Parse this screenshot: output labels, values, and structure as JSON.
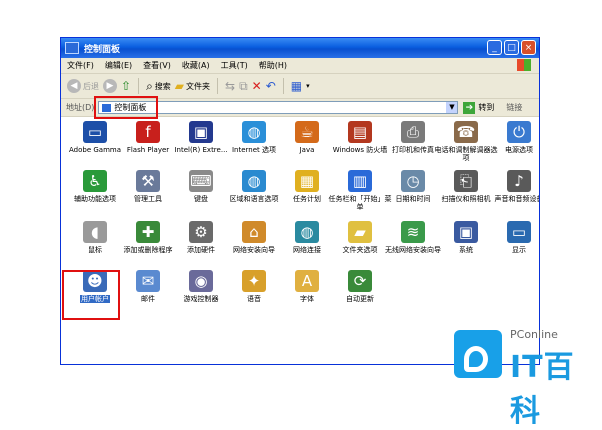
{
  "window": {
    "title": "控制面板",
    "controls": {
      "minimize": "_",
      "maximize": "□",
      "close": "×"
    }
  },
  "menu": [
    "文件(F)",
    "编辑(E)",
    "查看(V)",
    "收藏(A)",
    "工具(T)",
    "帮助(H)"
  ],
  "toolbar": {
    "back": "后退",
    "search": "搜索",
    "folders": "文件夹"
  },
  "address": {
    "label": "地址(D)",
    "value": "控制面板",
    "go": "转到",
    "links": "链接"
  },
  "items": [
    {
      "label": "Adobe Gamma",
      "icon": "monitor-icon",
      "color": "#1d4fa8"
    },
    {
      "label": "Flash Player",
      "icon": "flash-icon",
      "color": "#c8201c"
    },
    {
      "label": "Intel(R) Extre...",
      "icon": "intel-graphics-icon",
      "color": "#23398f"
    },
    {
      "label": "Internet 选项",
      "icon": "globe-icon",
      "color": "#2a8fd8"
    },
    {
      "label": "Java",
      "icon": "java-icon",
      "color": "#d46a1a"
    },
    {
      "label": "Windows 防火墙",
      "icon": "firewall-icon",
      "color": "#b3381f"
    },
    {
      "label": "打印机和传真",
      "icon": "printer-icon",
      "color": "#7a7a7a"
    },
    {
      "label": "电话和调制解调器选项",
      "icon": "phone-icon",
      "color": "#8a6a4a"
    },
    {
      "label": "电源选项",
      "icon": "power-icon",
      "color": "#3a7ad0"
    },
    {
      "label": "辅助功能选项",
      "icon": "accessibility-icon",
      "color": "#2a9a3a"
    },
    {
      "label": "管理工具",
      "icon": "admin-tools-icon",
      "color": "#6a7a9a"
    },
    {
      "label": "键盘",
      "icon": "keyboard-icon",
      "color": "#8a8a8a"
    },
    {
      "label": "区域和语言选项",
      "icon": "region-globe-icon",
      "color": "#2a8ad0"
    },
    {
      "label": "任务计划",
      "icon": "scheduled-tasks-icon",
      "color": "#e0b020"
    },
    {
      "label": "任务栏和「开始」菜单",
      "icon": "taskbar-icon",
      "color": "#2a6ad8"
    },
    {
      "label": "日期和时间",
      "icon": "clock-icon",
      "color": "#6a8aa8"
    },
    {
      "label": "扫描仪和照相机",
      "icon": "scanner-icon",
      "color": "#5a5a5a"
    },
    {
      "label": "声音和音频设备",
      "icon": "speaker-icon",
      "color": "#5a5a5a"
    },
    {
      "label": "鼠标",
      "icon": "mouse-icon",
      "color": "#9a9a9a"
    },
    {
      "label": "添加或删除程序",
      "icon": "add-remove-programs-icon",
      "color": "#3a8a3a"
    },
    {
      "label": "添加硬件",
      "icon": "add-hardware-icon",
      "color": "#6a6a6a"
    },
    {
      "label": "网络安装向导",
      "icon": "network-setup-icon",
      "color": "#d08a2a"
    },
    {
      "label": "网络连接",
      "icon": "network-connections-icon",
      "color": "#2a8aa0"
    },
    {
      "label": "文件夹选项",
      "icon": "folder-options-icon",
      "color": "#e0c040"
    },
    {
      "label": "无线网络安装向导",
      "icon": "wireless-icon",
      "color": "#3a9a4a"
    },
    {
      "label": "系统",
      "icon": "system-icon",
      "color": "#3a5aa0"
    },
    {
      "label": "显示",
      "icon": "display-icon",
      "color": "#2a6ab0"
    },
    {
      "label": "用户帐户",
      "icon": "user-accounts-icon",
      "color": "#3a6ab8"
    },
    {
      "label": "邮件",
      "icon": "mail-icon",
      "color": "#5a8ad0"
    },
    {
      "label": "游戏控制器",
      "icon": "game-controller-icon",
      "color": "#6a6a9a"
    },
    {
      "label": "语音",
      "icon": "speech-icon",
      "color": "#d8a02a"
    },
    {
      "label": "字体",
      "icon": "fonts-icon",
      "color": "#e0b040"
    },
    {
      "label": "自动更新",
      "icon": "auto-update-icon",
      "color": "#3a8a3a"
    }
  ],
  "watermark": {
    "brand": "PConline",
    "text": "IT百科"
  }
}
